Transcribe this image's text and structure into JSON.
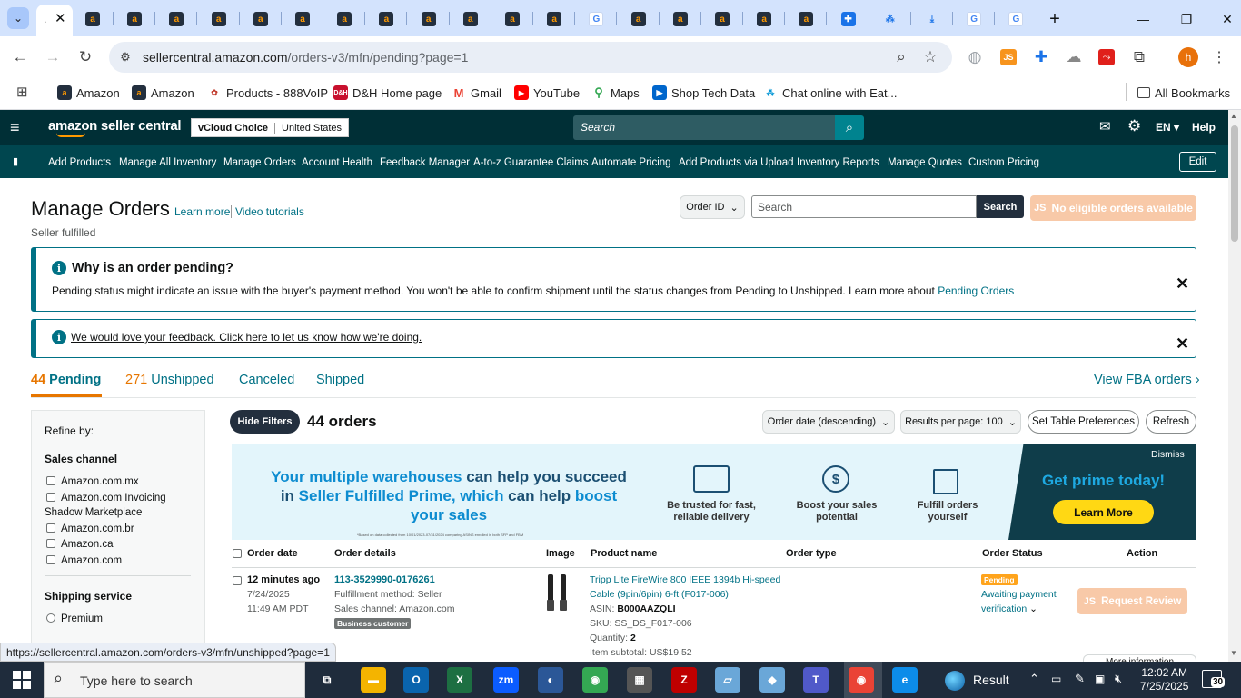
{
  "browser": {
    "active_tab_label": ".",
    "url_host": "sellercentral.amazon.com",
    "url_path": "/orders-v3/mfn/pending?page=1",
    "bookmarks": [
      "Amazon",
      "Amazon",
      "Products - 888VoIP",
      "D&H Home page",
      "Gmail",
      "YouTube",
      "Maps",
      "Shop Tech Data",
      "Chat online with Eat..."
    ],
    "all_bookmarks": "All Bookmarks",
    "status_url": "https://sellercentral.amazon.com/orders-v3/mfn/unshipped?page=1",
    "profile_initial": "h"
  },
  "header": {
    "logo": "amazon seller central",
    "store_name": "vCloud Choice",
    "marketplace": "United States",
    "search_placeholder": "Search",
    "language": "EN",
    "help": "Help"
  },
  "nav": {
    "items": [
      "Add Products",
      "Manage All Inventory",
      "Manage Orders",
      "Account Health",
      "Feedback Manager",
      "A-to-z Guarantee Claims",
      "Automate Pricing",
      "Add Products via Upload",
      "Inventory Reports",
      "Manage Quotes",
      "Custom Pricing"
    ],
    "edit": "Edit"
  },
  "page": {
    "title": "Manage Orders",
    "learn_more": "Learn more",
    "video_tutorials": "Video tutorials",
    "subtitle": "Seller fulfilled",
    "search_type": "Order ID",
    "search_placeholder": "Search",
    "search_button": "Search",
    "no_orders_button": "No eligible orders available"
  },
  "alerts": {
    "pending_title": "Why is an order pending?",
    "pending_body": "Pending status might indicate an issue with the buyer's payment method. You won't be able to confirm shipment until the status changes from Pending to Unshipped. Learn more about",
    "pending_link": "Pending Orders",
    "feedback_link": "We would love your feedback. Click here to let us know how we're doing."
  },
  "tabs": {
    "pending_count": "44",
    "pending_label": "Pending",
    "unshipped_count": "271",
    "unshipped_label": "Unshipped",
    "canceled": "Canceled",
    "shipped": "Shipped",
    "fba_link": "View FBA orders"
  },
  "toolbar": {
    "hide_filters": "Hide Filters",
    "orders_count": "44 orders",
    "sort": "Order date (descending)",
    "per_page": "Results per page: 100",
    "table_prefs": "Set Table Preferences",
    "refresh": "Refresh"
  },
  "refine": {
    "title": "Refine by:",
    "sales_channel_title": "Sales channel",
    "channels": [
      "Amazon.com.mx",
      "Amazon.com Invoicing",
      "Shadow Marketplace",
      "Amazon.com.br",
      "Amazon.ca",
      "Amazon.com"
    ],
    "shipping_title": "Shipping service",
    "shipping_options": [
      "Premium"
    ]
  },
  "banner": {
    "headline_1a": "Your multiple warehouses",
    "headline_1b": " can help you succeed",
    "headline_2a": "in ",
    "headline_2b": "Seller Fulfilled Prime, which",
    "headline_2c": " can help ",
    "headline_2d": "boost",
    "headline_3": "your sales",
    "footnote": "*Based on data collected from 10/01/2023-07/31/2024 comparing ASINS enrolled in both SFP and FBM",
    "feature_1": "Be trusted for fast, reliable delivery",
    "feature_2": "Boost your sales potential",
    "feature_3": "Fulfill orders yourself",
    "prime_text": "Get prime today!",
    "learn_more": "Learn More",
    "dismiss": "Dismiss"
  },
  "table": {
    "headers": [
      "Order date",
      "Order details",
      "Image",
      "Product name",
      "Order type",
      "Order Status",
      "Action"
    ],
    "rows": [
      {
        "age": "12 minutes ago",
        "date": "7/24/2025",
        "time": "11:49 AM PDT",
        "order_id": "113-3529990-0176261",
        "fulfillment": "Fulfillment method: Seller",
        "channel": "Sales channel: Amazon.com",
        "badge": "Business customer",
        "product_line1": "Tripp Lite FireWire 800 IEEE 1394b Hi-speed",
        "product_line2": "Cable (9pin/6pin) 6-ft.(F017-006)",
        "asin_label": "ASIN:",
        "asin": "B000AAZQLI",
        "sku": "SKU: SS_DS_F017-006",
        "qty_label": "Quantity:",
        "qty": "2",
        "subtotal": "Item subtotal: US$19.52",
        "status_badge": "Pending",
        "status_line1": "Awaiting payment",
        "status_line2": "verification",
        "action": "Request Review",
        "more_info": "More information"
      }
    ]
  },
  "taskbar": {
    "search_placeholder": "Type here to search",
    "weather": "Result",
    "time": "12:02 AM",
    "date": "7/25/2025",
    "notif_count": "30"
  },
  "colors": {
    "header_bg": "#002f36",
    "nav_bg": "#00464f",
    "accent_teal": "#007185",
    "accent_orange": "#e77600",
    "disabled_button": "#f8c9a8",
    "pending_badge": "#ffa41c"
  }
}
